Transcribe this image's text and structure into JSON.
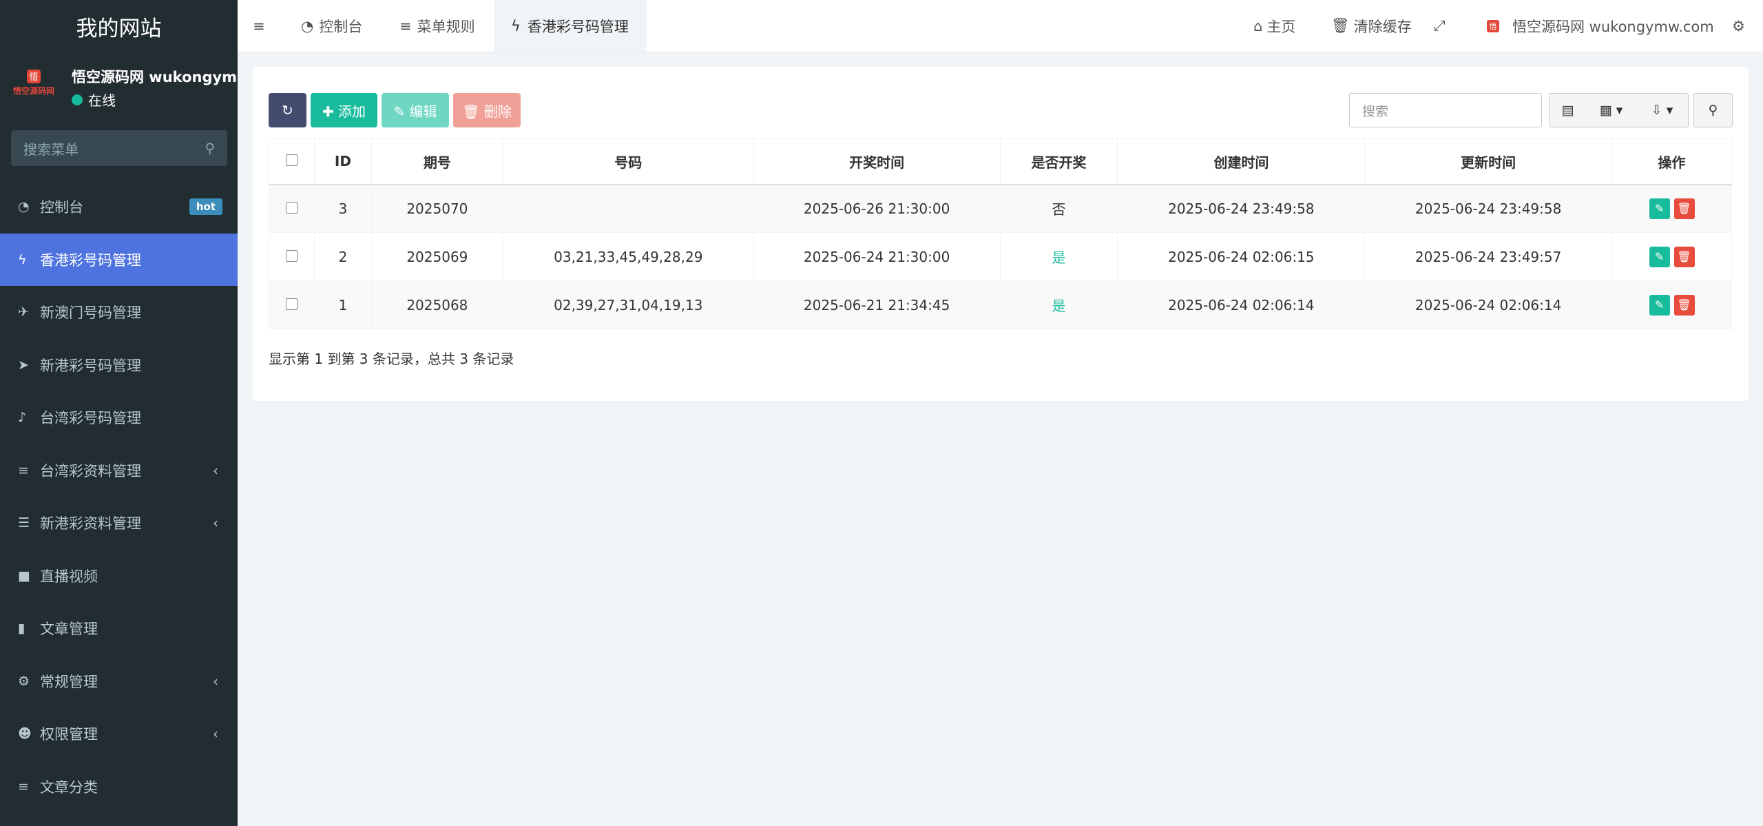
{
  "sidebar": {
    "site_title": "我的网站",
    "user_name": "悟空源码网 wukongymw.com",
    "user_status": "在线",
    "logo_text": "悟空源码网",
    "search_placeholder": "搜索菜单",
    "items": [
      {
        "label": "控制台",
        "icon": "dashboard-icon",
        "glyph": "◔",
        "badge": "hot"
      },
      {
        "label": "香港彩号码管理",
        "icon": "bolt-icon",
        "glyph": "ϟ",
        "active": true
      },
      {
        "label": "新澳门号码管理",
        "icon": "plane-icon",
        "glyph": "✈"
      },
      {
        "label": "新港彩号码管理",
        "icon": "send-icon",
        "glyph": "➤"
      },
      {
        "label": "台湾彩号码管理",
        "icon": "bell-icon",
        "glyph": "♪"
      },
      {
        "label": "台湾彩资料管理",
        "icon": "list-icon",
        "glyph": "≡",
        "chevron": "‹"
      },
      {
        "label": "新港彩资料管理",
        "icon": "list-alt-icon",
        "glyph": "☰",
        "chevron": "‹"
      },
      {
        "label": "直播视频",
        "icon": "video-icon",
        "glyph": "■"
      },
      {
        "label": "文章管理",
        "icon": "bookmark-icon",
        "glyph": "▮"
      },
      {
        "label": "常规管理",
        "icon": "cogs-icon",
        "glyph": "⚙",
        "chevron": "‹"
      },
      {
        "label": "权限管理",
        "icon": "users-icon",
        "glyph": "☻",
        "chevron": "‹"
      },
      {
        "label": "文章分类",
        "icon": "list-icon",
        "glyph": "≡"
      }
    ]
  },
  "topbar": {
    "menu_toggle": "≡",
    "tabs": [
      {
        "label": "控制台",
        "glyph": "◔"
      },
      {
        "label": "菜单规则",
        "glyph": "≡"
      },
      {
        "label": "香港彩号码管理",
        "glyph": "ϟ"
      }
    ],
    "home_label": "主页",
    "clear_cache_label": "清除缓存",
    "fullscreen_glyph": "⤢",
    "user_label": "悟空源码网 wukongymw.com",
    "settings_glyph": "⚙"
  },
  "toolbar": {
    "refresh_glyph": "↻",
    "add_label": "✚ 添加",
    "edit_label": "✎ 编辑",
    "delete_label": "🗑 删除",
    "search_placeholder": "搜索",
    "list_glyph": "▤",
    "columns_glyph": "▦ ▾",
    "export_glyph": "⇩ ▾",
    "search_glyph": "⚲"
  },
  "table": {
    "headers": [
      "",
      "ID",
      "期号",
      "号码",
      "开奖时间",
      "是否开奖",
      "创建时间",
      "更新时间",
      "操作"
    ],
    "rows": [
      {
        "id": "3",
        "issue": "2025070",
        "numbers": "",
        "draw_time": "2025-06-26 21:30:00",
        "drawn": "否",
        "created": "2025-06-24 23:49:58",
        "updated": "2025-06-24 23:49:58"
      },
      {
        "id": "2",
        "issue": "2025069",
        "numbers": "03,21,33,45,49,28,29",
        "draw_time": "2025-06-24 21:30:00",
        "drawn": "是",
        "created": "2025-06-24 02:06:15",
        "updated": "2025-06-24 23:49:57"
      },
      {
        "id": "1",
        "issue": "2025068",
        "numbers": "02,39,27,31,04,19,13",
        "draw_time": "2025-06-21 21:34:45",
        "drawn": "是",
        "created": "2025-06-24 02:06:14",
        "updated": "2025-06-24 02:06:14"
      }
    ],
    "edit_glyph": "✎",
    "delete_glyph": "🗑"
  },
  "footer": {
    "info": "显示第 1 到第 3 条记录，总共 3 条记录"
  },
  "colors": {
    "sidebar_bg": "#222d32",
    "active_menu": "#4e73df",
    "primary": "#18bc9c",
    "danger": "#e74c3c",
    "refresh_btn": "#444c6e"
  }
}
